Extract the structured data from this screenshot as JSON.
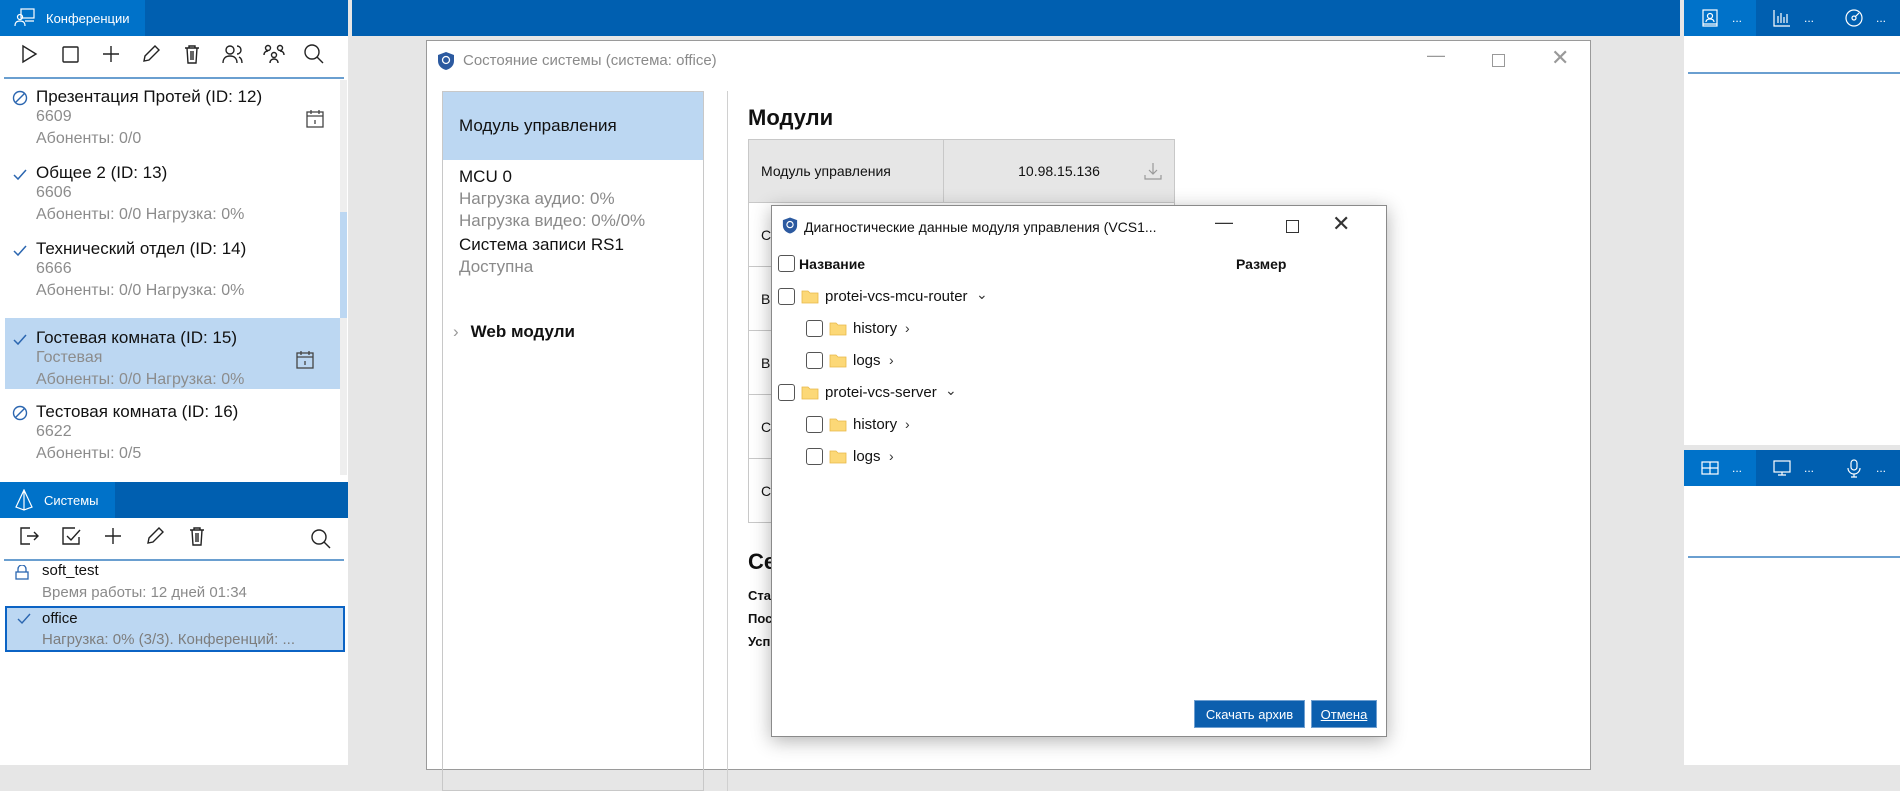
{
  "conferences": {
    "tab_label": "Конференции",
    "toolbar": [
      "play-icon",
      "stop-icon",
      "plus-icon",
      "pencil-icon",
      "trash-icon",
      "users-icon",
      "group-icon",
      "search-icon"
    ],
    "items": [
      {
        "title": "Презентация Протей (ID: 12)",
        "line1": "6609",
        "line2": "Абоненты: 0/0",
        "status": "inactive",
        "calendar": true,
        "selected": false
      },
      {
        "title": "Общее 2 (ID: 13)",
        "line1": "6606",
        "line2": "Абоненты: 0/0 Нагрузка: 0%",
        "status": "active",
        "calendar": false,
        "selected": false
      },
      {
        "title": "Технический отдел (ID: 14)",
        "line1": "6666",
        "line2": "Абоненты: 0/0 Нагрузка: 0%",
        "status": "active",
        "calendar": false,
        "selected": false
      },
      {
        "title": "Гостевая комната (ID: 15)",
        "line1": "Гостевая",
        "line2": "Абоненты: 0/0 Нагрузка: 0%",
        "status": "active",
        "calendar": true,
        "selected": true
      },
      {
        "title": "Тестовая комната (ID: 16)",
        "line1": "6622",
        "line2": "Абоненты: 0/5",
        "status": "inactive",
        "calendar": false,
        "selected": false
      }
    ]
  },
  "systems": {
    "tab_label": "Системы",
    "items": [
      {
        "name": "soft_test",
        "detail": "Время работы: 12 дней 01:34",
        "status": "locked"
      },
      {
        "name": "office",
        "detail": "Нагрузка: 0% (3/3). Конференций: ...",
        "status": "active",
        "selected": true
      }
    ]
  },
  "right_top_tabs": [
    {
      "icon": "contact-book-icon",
      "label": "..."
    },
    {
      "icon": "bar-chart-icon",
      "label": "..."
    },
    {
      "icon": "gauge-icon",
      "label": "..."
    }
  ],
  "right_bottom_tabs": [
    {
      "icon": "layout-grid-icon",
      "label": "..."
    },
    {
      "icon": "monitor-icon",
      "label": "..."
    },
    {
      "icon": "microphone-icon",
      "label": "..."
    }
  ],
  "status_window": {
    "title": "Состояние системы (система: office)",
    "nav": {
      "selected": "Модуль управления",
      "mcu_title": "MCU 0",
      "mcu_audio": "Нагрузка аудио: 0%",
      "mcu_video": "Нагрузка видео: 0%/0%",
      "rec_title": "Система записи RS1",
      "rec_status": "Доступна",
      "web_modules": "Web модули"
    },
    "modules_heading": "Модули",
    "modules_table": {
      "first_row": {
        "name": "Модуль управления",
        "address": "10.98.15.136"
      },
      "row_fragments": [
        "С",
        "В",
        "В",
        "С",
        "С"
      ]
    },
    "section2_heading": "Се",
    "section2_labels": [
      "Ста",
      "Пос",
      "Усп"
    ]
  },
  "diag_dialog": {
    "title": "Диагностические данные модуля управления (VCS1...",
    "col_name": "Название",
    "col_size": "Размер",
    "rows": [
      {
        "label": "protei-vcs-mcu-router",
        "level": 0,
        "expanded": true
      },
      {
        "label": "history",
        "level": 1,
        "expanded": false
      },
      {
        "label": "logs",
        "level": 1,
        "expanded": false
      },
      {
        "label": "protei-vcs-server",
        "level": 0,
        "expanded": true
      },
      {
        "label": "history",
        "level": 1,
        "expanded": false
      },
      {
        "label": "logs",
        "level": 1,
        "expanded": false
      }
    ],
    "download_button": "Скачать архив",
    "cancel_button": "Отмена"
  },
  "colors": {
    "header": "#005fb0",
    "active_tab": "#0072c9",
    "selection": "#bcd7f2",
    "button": "#0c5fae"
  }
}
